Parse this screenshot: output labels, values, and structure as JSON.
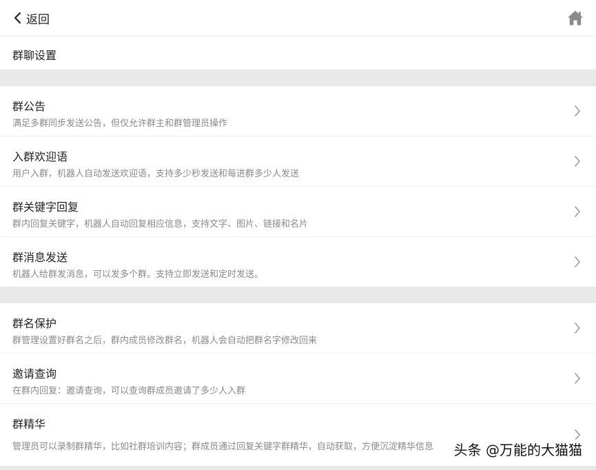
{
  "header": {
    "back_label": "返回",
    "back_icon": "chevron-left-icon",
    "home_icon": "home-icon"
  },
  "page": {
    "title": "群聊设置"
  },
  "sections": [
    {
      "items": [
        {
          "title": "群公告",
          "desc": "满足多群同步发送公告，但仅允许群主和群管理员操作"
        },
        {
          "title": "入群欢迎语",
          "desc": "用户入群，机器人自动发送欢迎语，支持多少秒发送和每进群多少人发送"
        },
        {
          "title": "群关键字回复",
          "desc": "群内回复关键字，机器人自动回复相应信息，支持文字、图片、链接和名片"
        },
        {
          "title": "群消息发送",
          "desc": "机器人给群发消息，可以发多个群。支持立即发送和定时发送。"
        }
      ]
    },
    {
      "items": [
        {
          "title": "群名保护",
          "desc": "群管理设置好群名之后，群内成员修改群名，机器人会自动把群名字修改回来"
        },
        {
          "title": "邀请查询",
          "desc": "在群内回复：邀请查询，可以查询群成员邀请了多少人入群"
        },
        {
          "title": "群精华",
          "desc": "管理员可以录制群精华，比如社群培训内容；群成员通过回复关键字群精华，自动获取，方便沉淀精华信息"
        }
      ]
    }
  ],
  "watermark": "头条 @万能的大猫猫",
  "colors": {
    "background": "#e9e9e9",
    "card": "#ffffff",
    "desc_text": "#8a8a8a",
    "icon": "#8a8a8a"
  }
}
